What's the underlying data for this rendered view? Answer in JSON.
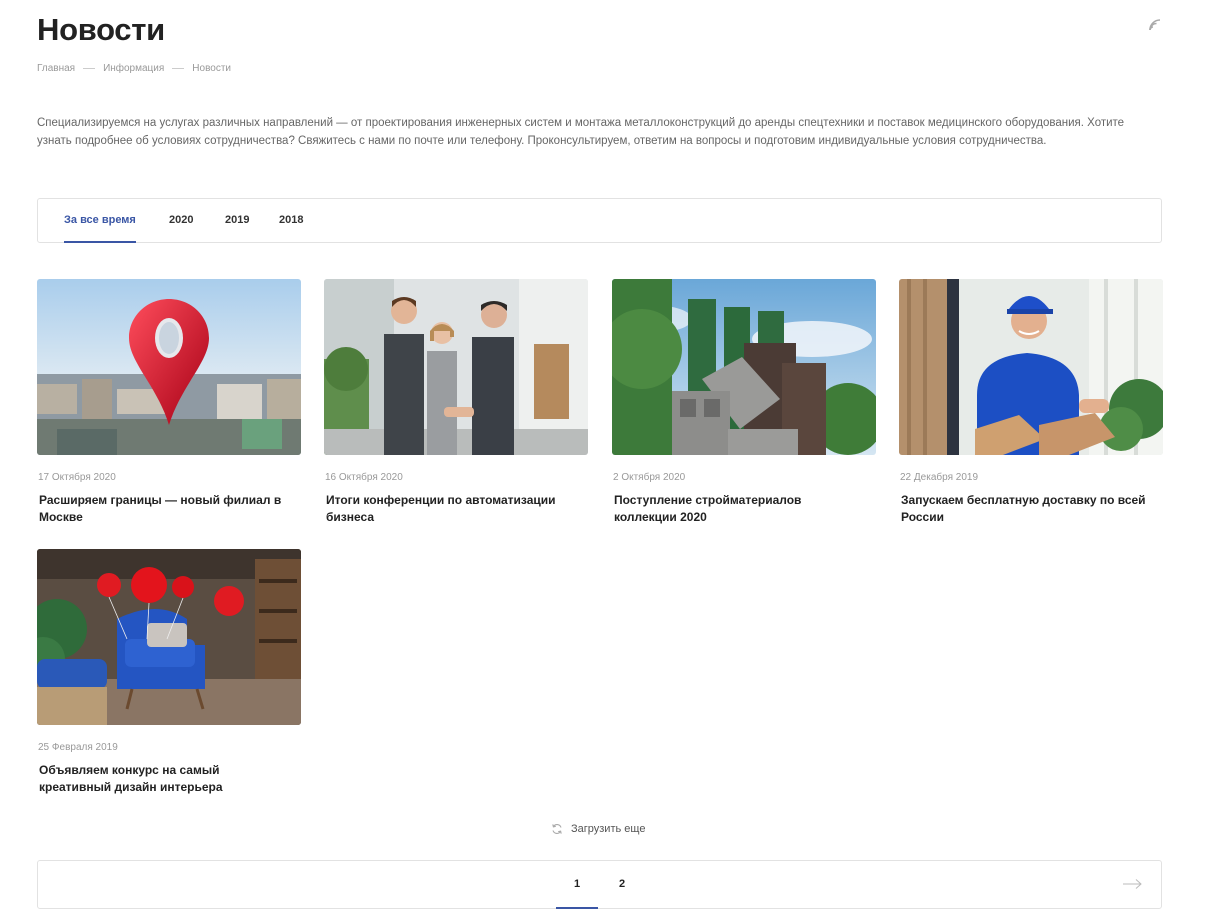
{
  "page": {
    "title": "Новости",
    "rss_icon": "rss-icon"
  },
  "breadcrumb": [
    "Главная",
    "Информация",
    "Новости"
  ],
  "intro": "Специализируемся на услугах различных направлений — от проектирования инженерных систем и монтажа металлоконструкций до аренды спецтехники и поставок медицинского оборудования. Хотите узнать подробнее об условиях сотрудничества? Свяжитесь с нами по почте или телефону. Проконсультируем, ответим на вопросы и подготовим индивидуальные условия сотрудничества.",
  "tabs": [
    {
      "label": "За все время",
      "active": true
    },
    {
      "label": "2020",
      "active": false
    },
    {
      "label": "2019",
      "active": false
    },
    {
      "label": "2018",
      "active": false
    }
  ],
  "news": [
    {
      "date": "17 Октября 2020",
      "title": "Расширяем границы — новый филиал в Москве",
      "image": "city-location-pin"
    },
    {
      "date": "16 Октября 2020",
      "title": "Итоги конференции по автоматизации бизнеса",
      "image": "business-handshake"
    },
    {
      "date": "2 Октября 2020",
      "title": "Поступление стройматериалов коллекции 2020",
      "image": "building-materials"
    },
    {
      "date": "22 Декабря 2019",
      "title": "Запускаем бесплатную доставку по всей России",
      "image": "courier-with-boxes"
    },
    {
      "date": "25 Февраля 2019",
      "title": "Объявляем конкурс на самый креативный дизайн интерьера",
      "image": "blue-armchair-balloons"
    }
  ],
  "load_more": {
    "label": "Загрузить еще",
    "icon": "refresh-icon"
  },
  "pagination": {
    "pages": [
      "1",
      "2"
    ],
    "current": "1",
    "next_icon": "arrow-right-icon"
  },
  "colors": {
    "accent": "#3a56a5",
    "text": "#222222",
    "muted": "#999999",
    "border": "#e2e2e2"
  }
}
